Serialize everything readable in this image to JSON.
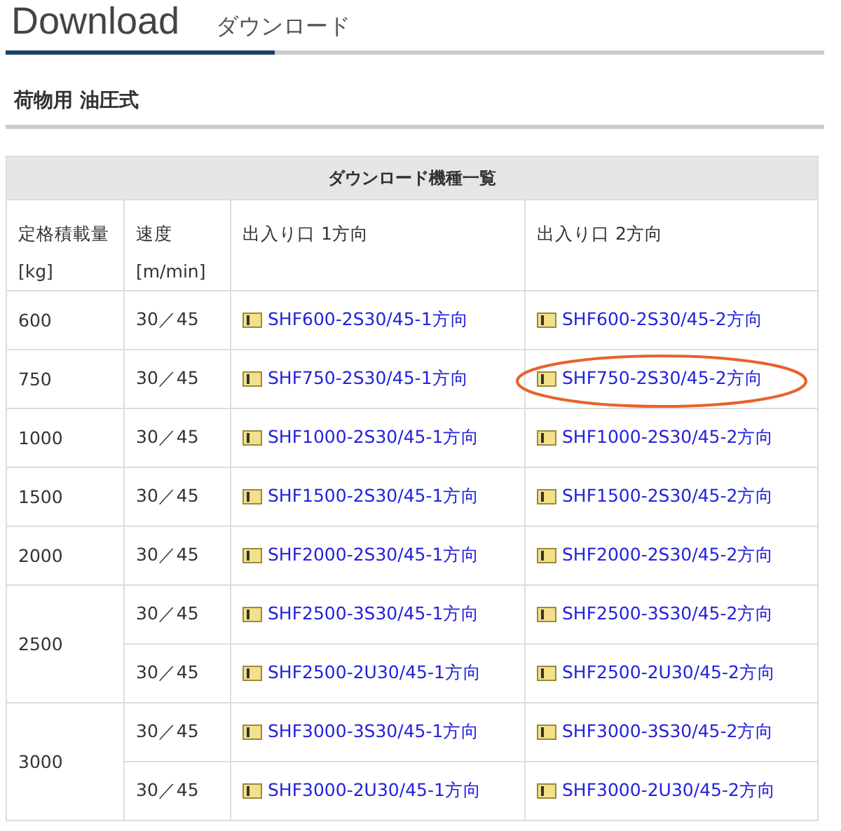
{
  "header": {
    "title": "Download",
    "subtitle": "ダウンロード"
  },
  "section_title": "荷物用 油圧式",
  "table": {
    "caption": "ダウンロード機種一覧",
    "columns": [
      {
        "lines": [
          "定格積載量",
          "[kg]"
        ]
      },
      {
        "lines": [
          "速度",
          "[m/min]"
        ]
      },
      {
        "lines": [
          "出入り口 1方向"
        ]
      },
      {
        "lines": [
          "出入り口 2方向"
        ]
      }
    ],
    "groups": [
      {
        "capacity": "600",
        "rows": [
          {
            "speed": "30／45",
            "links": [
              {
                "label": "SHF600-2S30/45-1方向",
                "circled": false
              },
              {
                "label": "SHF600-2S30/45-2方向",
                "circled": false
              }
            ]
          }
        ]
      },
      {
        "capacity": "750",
        "rows": [
          {
            "speed": "30／45",
            "links": [
              {
                "label": "SHF750-2S30/45-1方向",
                "circled": false
              },
              {
                "label": "SHF750-2S30/45-2方向",
                "circled": true
              }
            ]
          }
        ]
      },
      {
        "capacity": "1000",
        "rows": [
          {
            "speed": "30／45",
            "links": [
              {
                "label": "SHF1000-2S30/45-1方向",
                "circled": false
              },
              {
                "label": "SHF1000-2S30/45-2方向",
                "circled": false
              }
            ]
          }
        ]
      },
      {
        "capacity": "1500",
        "rows": [
          {
            "speed": "30／45",
            "links": [
              {
                "label": "SHF1500-2S30/45-1方向",
                "circled": false
              },
              {
                "label": "SHF1500-2S30/45-2方向",
                "circled": false
              }
            ]
          }
        ]
      },
      {
        "capacity": "2000",
        "rows": [
          {
            "speed": "30／45",
            "links": [
              {
                "label": "SHF2000-2S30/45-1方向",
                "circled": false
              },
              {
                "label": "SHF2000-2S30/45-2方向",
                "circled": false
              }
            ]
          }
        ]
      },
      {
        "capacity": "2500",
        "rows": [
          {
            "speed": "30／45",
            "links": [
              {
                "label": "SHF2500-3S30/45-1方向",
                "circled": false
              },
              {
                "label": "SHF2500-3S30/45-2方向",
                "circled": false
              }
            ]
          },
          {
            "speed": "30／45",
            "links": [
              {
                "label": "SHF2500-2U30/45-1方向",
                "circled": false
              },
              {
                "label": "SHF2500-2U30/45-2方向",
                "circled": false
              }
            ]
          }
        ]
      },
      {
        "capacity": "3000",
        "rows": [
          {
            "speed": "30／45",
            "links": [
              {
                "label": "SHF3000-3S30/45-1方向",
                "circled": false
              },
              {
                "label": "SHF3000-3S30/45-2方向",
                "circled": false
              }
            ]
          },
          {
            "speed": "30／45",
            "links": [
              {
                "label": "SHF3000-2U30/45-1方向",
                "circled": false
              },
              {
                "label": "SHF3000-2U30/45-2方向",
                "circled": false
              }
            ]
          }
        ]
      }
    ]
  }
}
